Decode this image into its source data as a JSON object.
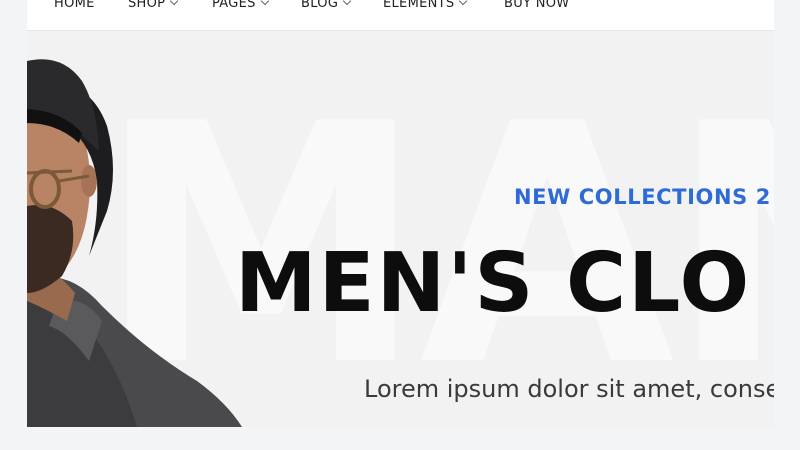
{
  "nav": {
    "items": [
      {
        "label": "HOME",
        "has_dropdown": false
      },
      {
        "label": "SHOP",
        "has_dropdown": true
      },
      {
        "label": "PAGES",
        "has_dropdown": true
      },
      {
        "label": "BLOG",
        "has_dropdown": true
      },
      {
        "label": "ELEMENTS",
        "has_dropdown": true
      },
      {
        "label": "BUY NOW",
        "has_dropdown": false
      }
    ]
  },
  "hero": {
    "eyebrow": "NEW COLLECTIONS 2",
    "headline": "MEN'S CLO",
    "subtext": "Lorem ipsum dolor sit amet, conse",
    "image": "man-in-hat-and-glasses",
    "colors": {
      "accent": "#2f6bd6",
      "headline": "#0d0d0d",
      "background": "#f2f2f2"
    }
  }
}
